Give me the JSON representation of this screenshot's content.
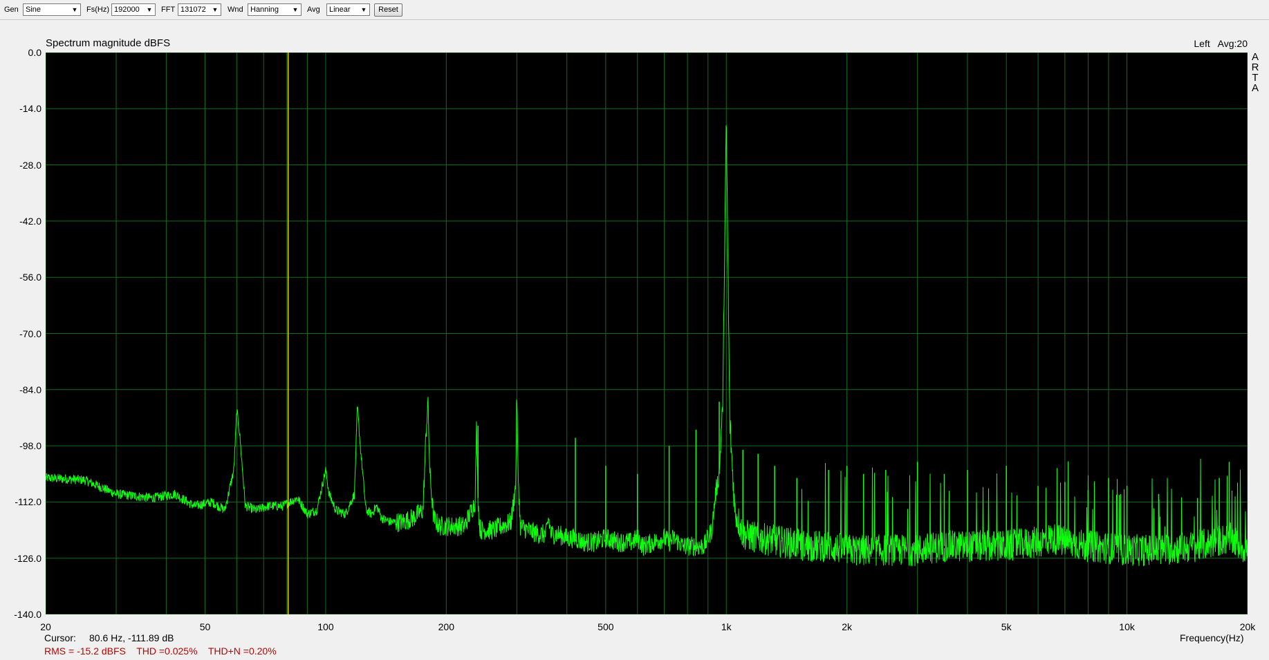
{
  "toolbar": {
    "gen_label": "Gen",
    "gen_value": "Sine",
    "fs_label": "Fs(Hz)",
    "fs_value": "192000",
    "fft_label": "FFT",
    "fft_value": "131072",
    "wnd_label": "Wnd",
    "wnd_value": "Hanning",
    "avg_label": "Avg",
    "avg_value": "Linear",
    "reset_label": "Reset"
  },
  "plot": {
    "title": "Spectrum magnitude dBFS",
    "channel": "Left",
    "avg": "Avg:20",
    "brand_letters": [
      "A",
      "R",
      "T",
      "A"
    ],
    "cursor_label": "Cursor:",
    "cursor_value": "80.6 Hz, -111.89 dB",
    "rms": "RMS =  -15.2 dBFS",
    "thd": "THD =0.025%",
    "thdn": "THD+N =0.20%"
  },
  "colors": {
    "plot_background": "#000000",
    "grid": "#0f6e1a",
    "trace": "#10ff10",
    "cursor": "#e8d000",
    "stats_text": "#c00000"
  },
  "chart_data": {
    "type": "line",
    "title": "Spectrum magnitude dBFS",
    "xlabel": "Frequency(Hz)",
    "ylabel": "",
    "x_scale": "log",
    "xlim": [
      20,
      20000
    ],
    "ylim": [
      -140,
      0
    ],
    "grid": true,
    "x_ticks": [
      "20",
      "50",
      "100",
      "200",
      "500",
      "1k",
      "2k",
      "5k",
      "10k",
      "20k"
    ],
    "y_ticks": [
      "0.0",
      "-14.0",
      "-28.0",
      "-42.0",
      "-56.0",
      "-70.0",
      "-84.0",
      "-98.0",
      "-112.0",
      "-126.0",
      "-140.0"
    ],
    "cursor": {
      "x": 80.6,
      "y": -111.89
    },
    "series": [
      {
        "x": [
          20,
          25,
          30,
          37,
          42,
          47,
          52,
          56,
          59,
          60,
          61,
          63,
          67,
          72,
          78,
          85,
          90,
          95,
          98,
          100,
          102,
          106,
          112,
          118,
          120,
          122,
          126,
          130,
          134,
          138,
          145,
          155,
          165,
          175,
          178,
          180,
          182,
          186,
          192,
          198,
          210,
          222,
          236,
          238,
          240,
          242,
          244,
          250,
          262,
          275,
          290,
          298,
          300,
          302,
          306,
          320,
          340,
          355,
          360,
          365,
          380,
          400,
          420,
          440,
          470,
          500,
          540,
          580,
          600,
          620,
          660,
          700,
          720,
          740,
          780,
          800,
          840,
          880,
          920,
          940,
          960,
          980,
          990,
          1000,
          1010,
          1020,
          1050,
          1100,
          1200,
          1400,
          1600,
          1800,
          2000,
          2500,
          3000,
          3500,
          4000,
          5000,
          6000,
          6500,
          7000,
          8000,
          10000,
          12000,
          15000,
          18000,
          20000
        ],
        "y": [
          -106,
          -106.5,
          -110,
          -111,
          -110,
          -113,
          -112,
          -114,
          -104,
          -89,
          -95,
          -113,
          -114,
          -113,
          -113,
          -111,
          -115,
          -114,
          -108,
          -104,
          -110,
          -114,
          -115,
          -110,
          -88,
          -98,
          -114,
          -115,
          -113,
          -116,
          -117,
          -117,
          -116,
          -114,
          -95,
          -87,
          -105,
          -116,
          -118,
          -118,
          -118,
          -118,
          -112,
          -93,
          -111,
          -118,
          -119,
          -119,
          -119,
          -118,
          -117,
          -108,
          -84,
          -104,
          -118,
          -119,
          -120,
          -120,
          -116,
          -120,
          -120,
          -121,
          -121,
          -122,
          -122,
          -121,
          -122,
          -122,
          -121,
          -123,
          -122,
          -121,
          -122,
          -121,
          -123,
          -123,
          -123,
          -123,
          -119,
          -110,
          -105,
          -87,
          -50,
          -16.5,
          -55,
          -92,
          -114,
          -120,
          -121,
          -122,
          -123,
          -123,
          -124,
          -124,
          -124,
          -123,
          -123,
          -123,
          -122,
          -121,
          -122,
          -123,
          -124,
          -124,
          -123,
          -121,
          -124
        ]
      }
    ],
    "annotations": [
      {
        "x": 60,
        "y": -89
      },
      {
        "x": 120,
        "y": -88
      },
      {
        "x": 180,
        "y": -87
      },
      {
        "x": 240,
        "y": -93
      },
      {
        "x": 300,
        "y": -84
      },
      {
        "x": 360,
        "y": -116
      },
      {
        "x": 420,
        "y": -96
      },
      {
        "x": 500,
        "y": -103
      },
      {
        "x": 600,
        "y": -105
      },
      {
        "x": 720,
        "y": -98
      },
      {
        "x": 840,
        "y": -94
      },
      {
        "x": 960,
        "y": -87
      },
      {
        "x": 1000,
        "y": -16.5
      },
      {
        "x": 1100,
        "y": -99
      },
      {
        "x": 1200,
        "y": -100
      },
      {
        "x": 1320,
        "y": -103
      },
      {
        "x": 1500,
        "y": -106
      },
      {
        "x": 1800,
        "y": -104
      },
      {
        "x": 2000,
        "y": -103
      },
      {
        "x": 2200,
        "y": -105
      },
      {
        "x": 2500,
        "y": -104
      },
      {
        "x": 3000,
        "y": -102
      },
      {
        "x": 3500,
        "y": -105
      },
      {
        "x": 4000,
        "y": -104
      },
      {
        "x": 5000,
        "y": -103
      },
      {
        "x": 6000,
        "y": -108
      },
      {
        "x": 7000,
        "y": -107
      },
      {
        "x": 8000,
        "y": -109
      },
      {
        "x": 9000,
        "y": -106
      },
      {
        "x": 10000,
        "y": -108
      },
      {
        "x": 12000,
        "y": -110
      },
      {
        "x": 15000,
        "y": -111
      },
      {
        "x": 17000,
        "y": -106
      },
      {
        "x": 18000,
        "y": -102
      }
    ]
  }
}
